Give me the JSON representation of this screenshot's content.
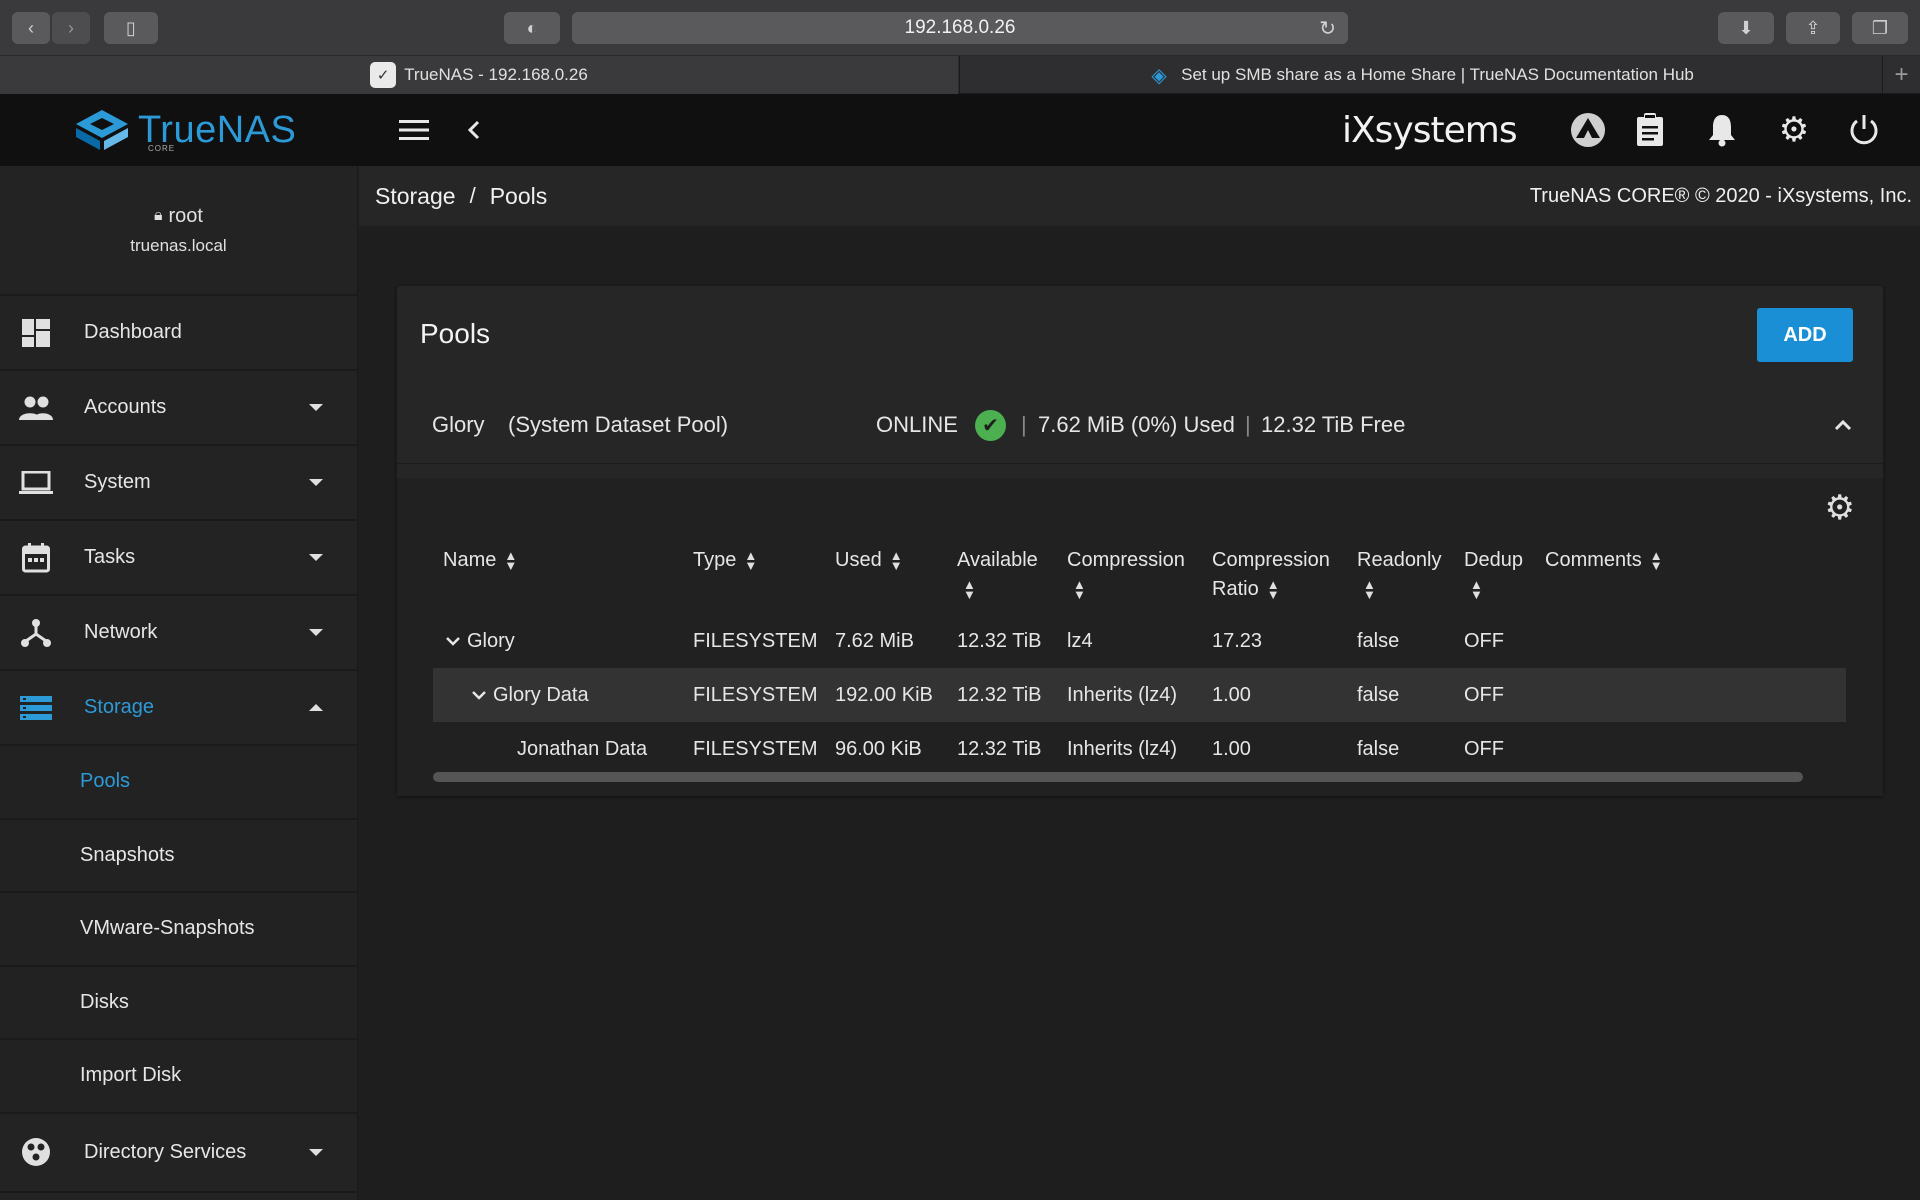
{
  "browser": {
    "url": "192.168.0.26",
    "tabs": [
      {
        "label": "TrueNAS - 192.168.0.26",
        "active": true
      },
      {
        "label": "Set up SMB share as a Home Share | TrueNAS Documentation Hub",
        "active": false
      }
    ]
  },
  "header": {
    "logo_text": "TrueNAS",
    "logo_sub": "CORE",
    "vendor_logo": "iXsystems"
  },
  "sidebar": {
    "user": "root",
    "host": "truenas.local",
    "items": [
      {
        "label": "Dashboard",
        "icon": "dashboard-icon"
      },
      {
        "label": "Accounts",
        "icon": "accounts-icon"
      },
      {
        "label": "System",
        "icon": "laptop-icon"
      },
      {
        "label": "Tasks",
        "icon": "calendar-icon"
      },
      {
        "label": "Network",
        "icon": "network-icon"
      },
      {
        "label": "Storage",
        "icon": "storage-icon"
      },
      {
        "label": "Directory Services",
        "icon": "directory-services-icon"
      }
    ],
    "storage_sub": [
      "Pools",
      "Snapshots",
      "VMware-Snapshots",
      "Disks",
      "Import Disk"
    ]
  },
  "breadcrumb": {
    "root": "Storage",
    "sep": "/",
    "current": "Pools"
  },
  "copyright": "TrueNAS CORE® © 2020 - iXsystems, Inc.",
  "pools": {
    "title": "Pools",
    "add_label": "ADD",
    "pool": {
      "name": "Glory",
      "tag": "(System Dataset Pool)",
      "status": "ONLINE",
      "used": "7.62 MiB (0%) Used",
      "free": "12.32 TiB Free",
      "divider": "|"
    },
    "columns": {
      "name": "Name",
      "type": "Type",
      "used": "Used",
      "available": "Available",
      "compression": "Compression",
      "ratio_1": "Compression",
      "ratio_2": "Ratio",
      "readonly": "Readonly",
      "dedup": "Dedup",
      "comments": "Comments"
    },
    "rows": [
      {
        "name": "Glory",
        "type": "FILESYSTEM",
        "used": "7.62 MiB",
        "available": "12.32 TiB",
        "compression": "lz4",
        "ratio": "17.23",
        "readonly": "false",
        "dedup": "OFF"
      },
      {
        "name": "Glory Data",
        "type": "FILESYSTEM",
        "used": "192.00 KiB",
        "available": "12.32 TiB",
        "compression": "Inherits (lz4)",
        "ratio": "1.00",
        "readonly": "false",
        "dedup": "OFF"
      },
      {
        "name": "Jonathan Data",
        "type": "FILESYSTEM",
        "used": "96.00 KiB",
        "available": "12.32 TiB",
        "compression": "Inherits (lz4)",
        "ratio": "1.00",
        "readonly": "false",
        "dedup": "OFF"
      }
    ]
  },
  "colors": {
    "accent": "#2d9ad8",
    "online": "#4caf50",
    "add_button": "#1a8fd6"
  }
}
